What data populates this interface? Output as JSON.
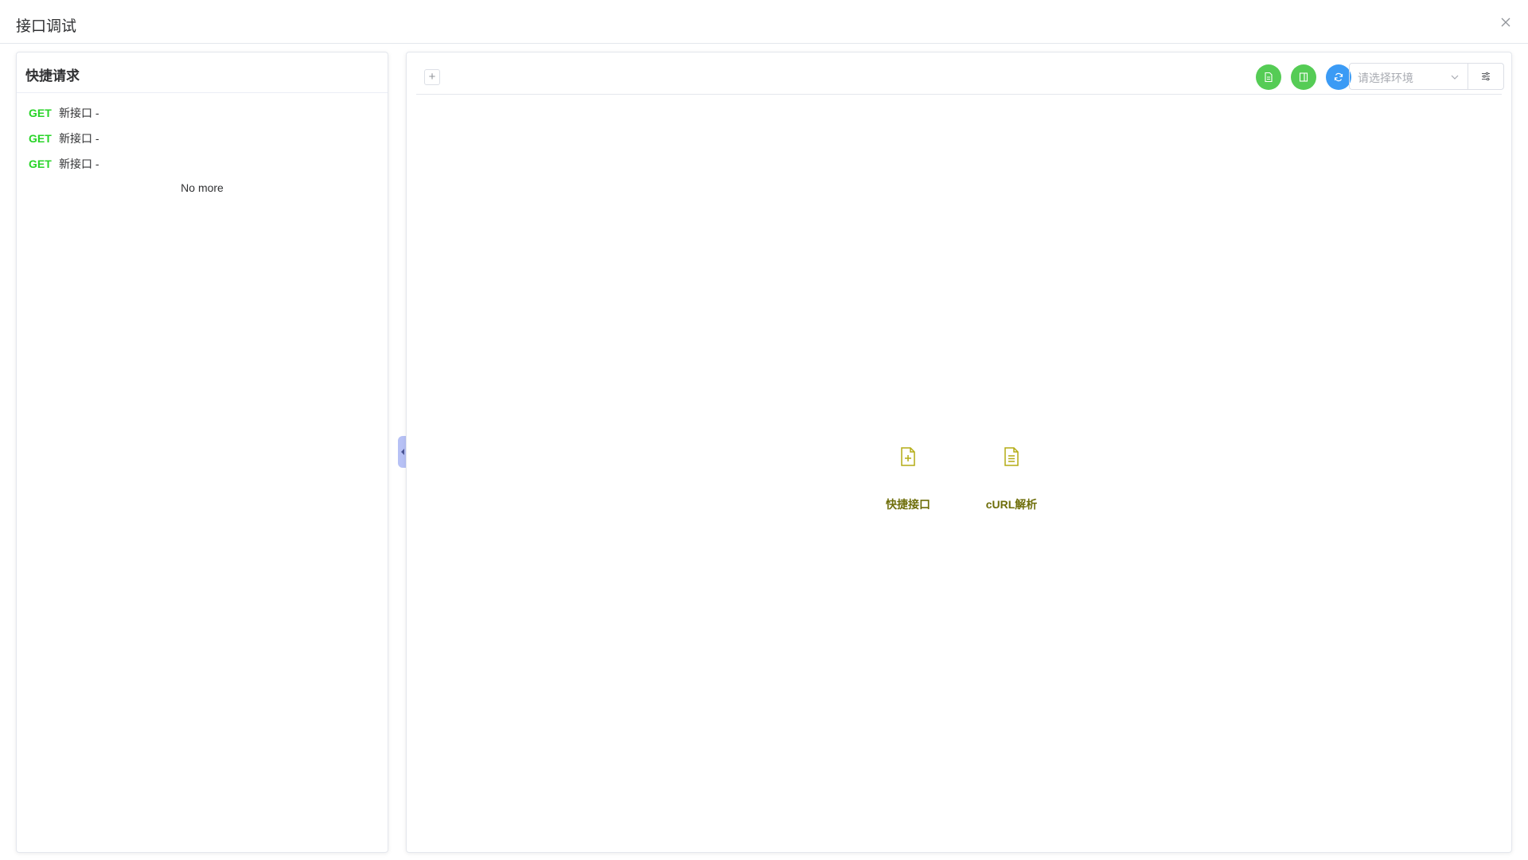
{
  "header": {
    "title": "接口调试"
  },
  "left_panel": {
    "title": "快捷请求",
    "requests": [
      {
        "method": "GET",
        "name": "新接口 -"
      },
      {
        "method": "GET",
        "name": "新接口 -"
      },
      {
        "method": "GET",
        "name": "新接口 -"
      }
    ],
    "no_more": "No more"
  },
  "toolbar": {
    "add_tab_label": "+",
    "env_placeholder": "请选择环境",
    "icons": [
      "doc-icon",
      "panel-icon",
      "refresh-icon",
      "chevron-down-icon",
      "sliders-icon"
    ]
  },
  "center": {
    "actions": [
      {
        "label": "快捷接口",
        "icon": "file-add-icon"
      },
      {
        "label": "cURL解析",
        "icon": "file-text-icon"
      }
    ]
  },
  "colors": {
    "get_method": "#27d427",
    "green_button": "#55cc55",
    "blue_button": "#3b9bf5",
    "action_icon": "#b4ac14",
    "action_label": "#6e6e0a",
    "collapse_handle": "#b7c1f5"
  }
}
